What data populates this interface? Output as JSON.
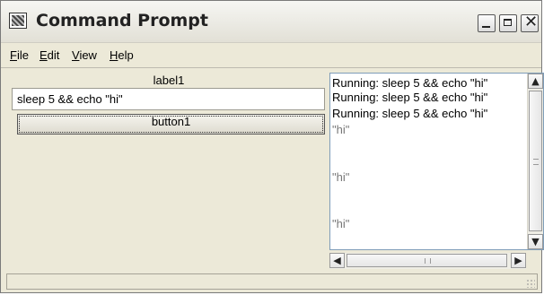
{
  "window": {
    "title": "Command Prompt"
  },
  "menu": {
    "items": [
      {
        "label": "File",
        "accel": "F",
        "rest": "ile"
      },
      {
        "label": "Edit",
        "accel": "E",
        "rest": "dit"
      },
      {
        "label": "View",
        "accel": "V",
        "rest": "iew"
      },
      {
        "label": "Help",
        "accel": "H",
        "rest": "elp"
      }
    ]
  },
  "form": {
    "label1": "label1",
    "command_value": "sleep 5 && echo \"hi\"",
    "button1": "button1"
  },
  "output": {
    "lines": [
      "Running: sleep 5 && echo \"hi\"",
      "Running: sleep 5 && echo \"hi\"",
      "Running: sleep 5 && echo \"hi\"",
      "\"hi\"",
      "\"hi\"",
      "\"hi\""
    ]
  },
  "icons": {
    "app": "console-icon",
    "minimize": "minimize-icon",
    "maximize": "maximize-icon",
    "close": "close-icon",
    "scroll_up": "arrow-up-icon",
    "scroll_down": "arrow-down-icon",
    "scroll_left": "arrow-left-icon",
    "scroll_right": "arrow-right-icon"
  }
}
